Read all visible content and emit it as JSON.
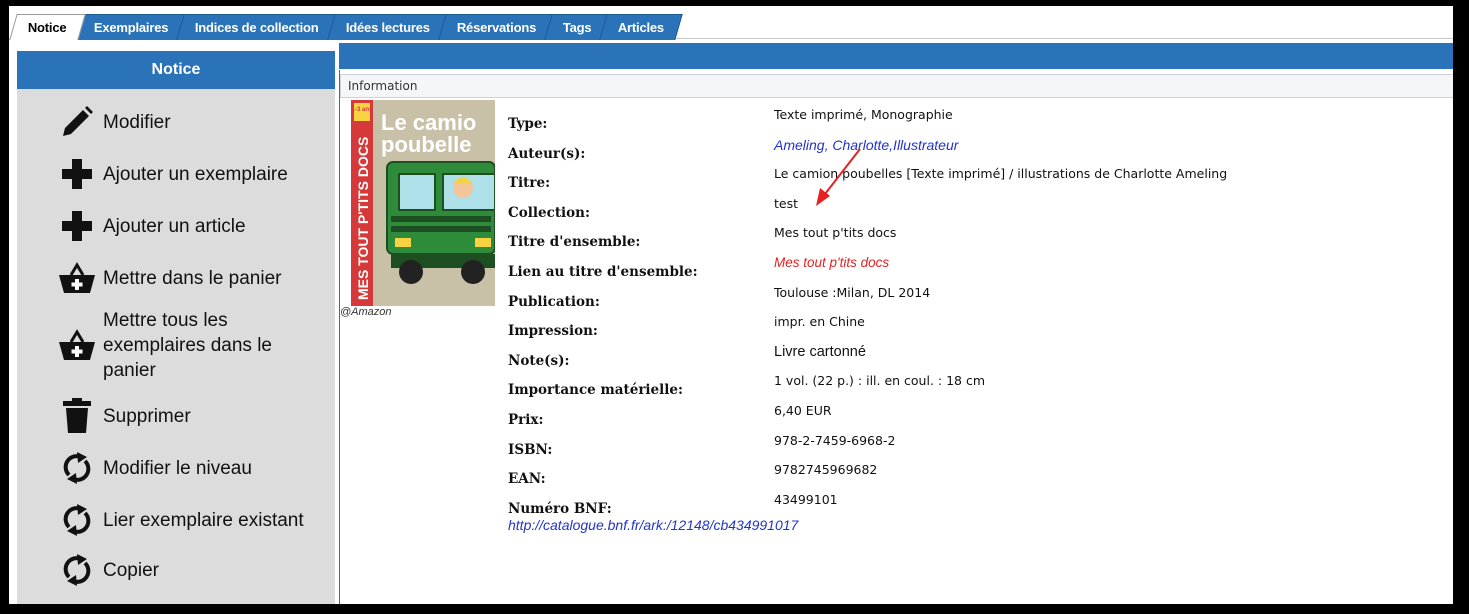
{
  "tabs": [
    {
      "label": "Notice",
      "active": true
    },
    {
      "label": "Exemplaires",
      "active": false
    },
    {
      "label": "Indices de collection",
      "active": false
    },
    {
      "label": "Idées lectures",
      "active": false
    },
    {
      "label": "Réservations",
      "active": false
    },
    {
      "label": "Tags",
      "active": false
    },
    {
      "label": "Articles",
      "active": false
    }
  ],
  "sidebar": {
    "title": "Notice",
    "items": [
      {
        "label": "Modifier",
        "icon": "pencil-icon"
      },
      {
        "label": "Ajouter un exemplaire",
        "icon": "plus-icon"
      },
      {
        "label": "Ajouter un article",
        "icon": "plus-icon"
      },
      {
        "label": "Mettre dans le panier",
        "icon": "basket-add-icon"
      },
      {
        "label": "Mettre tous les exemplaires dans le panier",
        "lines": [
          "Mettre tous les",
          "exemplaires dans le",
          "panier"
        ],
        "icon": "basket-add-icon"
      },
      {
        "label": "Supprimer",
        "icon": "trash-icon"
      },
      {
        "label": "Modifier le niveau",
        "icon": "refresh-icon"
      },
      {
        "label": "Lier exemplaire existant",
        "icon": "refresh-icon"
      },
      {
        "label": "Copier",
        "icon": "refresh-icon"
      }
    ]
  },
  "panel": {
    "section_title": "Information",
    "cover": {
      "badge": "1-3 ans",
      "series_text": "MES TOUT P'TITS DOCS",
      "title_text": [
        "Le camio",
        "poubelle"
      ],
      "credit": "@Amazon"
    },
    "fields": [
      {
        "label": "Type:",
        "value": "Texte imprimé, Monographie",
        "style": "normal"
      },
      {
        "label": "Auteur(s):",
        "value": "Ameling, Charlotte,Illustrateur",
        "style": "link"
      },
      {
        "label": "Titre:",
        "value": "Le camion poubelles [Texte imprimé] / illustrations de Charlotte Ameling",
        "style": "normal"
      },
      {
        "label": "Collection:",
        "value": "test",
        "style": "normal"
      },
      {
        "label": "Titre d'ensemble:",
        "value": "Mes tout p'tits docs",
        "style": "normal"
      },
      {
        "label": "Lien au titre d'ensemble:",
        "value": "Mes tout p'tits docs",
        "style": "red"
      },
      {
        "label": "Publication:",
        "value": "Toulouse :Milan, DL 2014",
        "style": "normal"
      },
      {
        "label": "Impression:",
        "value": "impr. en Chine",
        "style": "normal"
      },
      {
        "label": "Note(s):",
        "value": "Livre cartonné",
        "style": "plain"
      },
      {
        "label": "Importance matérielle:",
        "value": "1 vol. (22 p.) : ill. en coul. : 18 cm",
        "style": "normal"
      },
      {
        "label": "Prix:",
        "value": "6,40 EUR",
        "style": "normal"
      },
      {
        "label": "ISBN:",
        "value": "978-2-7459-6968-2",
        "style": "normal"
      },
      {
        "label": "EAN:",
        "value": "9782745969682",
        "style": "normal"
      },
      {
        "label": "Numéro BNF:",
        "value": "43499101",
        "style": "normal"
      }
    ],
    "bnf_link": "http://catalogue.bnf.fr/ark:/12148/cb434991017"
  },
  "colors": {
    "tab_blue": "#2a73b8",
    "sidebar_bg": "#dcdcdc",
    "link_blue": "#2233cc",
    "link_red": "#e32222",
    "arrow_red": "#e32222"
  }
}
